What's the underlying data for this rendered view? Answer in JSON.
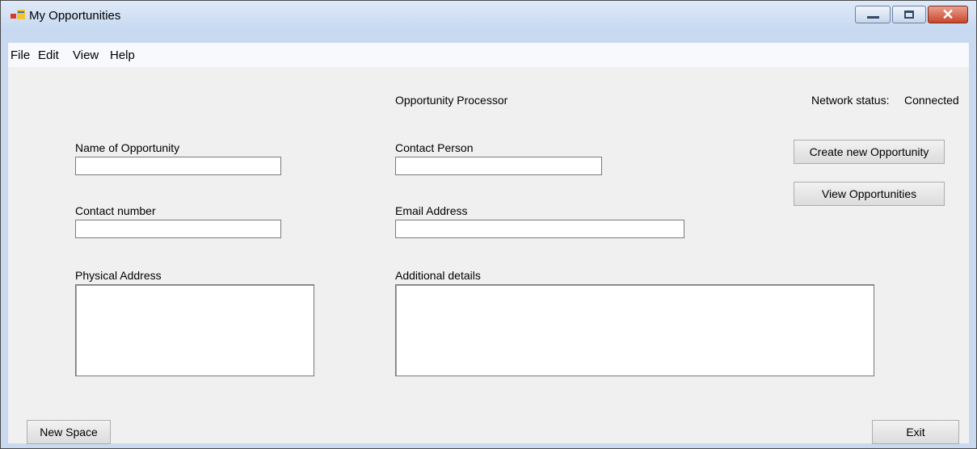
{
  "window": {
    "title": "My Opportunities"
  },
  "menu": [
    "File",
    "Edit",
    "View",
    "Help"
  ],
  "form": {
    "heading": "Opportunity Processor",
    "network_status_label": "Network status:",
    "network_status_value": "Connected",
    "name_label": "Name of Opportunity",
    "name_value": "",
    "contact_person_label": "Contact Person",
    "contact_person_value": "",
    "contact_number_label": "Contact number",
    "contact_number_value": "",
    "email_label": "Email Address",
    "email_value": "",
    "address_label": "Physical Address",
    "address_value": "",
    "details_label": "Additional details",
    "details_value": ""
  },
  "buttons": {
    "create": "Create new Opportunity",
    "view": "View Opportunities",
    "new_space": "New Space",
    "exit": "Exit"
  },
  "icons": {
    "app": "app-window-icon",
    "minimize": "minimize-icon",
    "maximize": "maximize-icon",
    "close": "close-icon"
  }
}
